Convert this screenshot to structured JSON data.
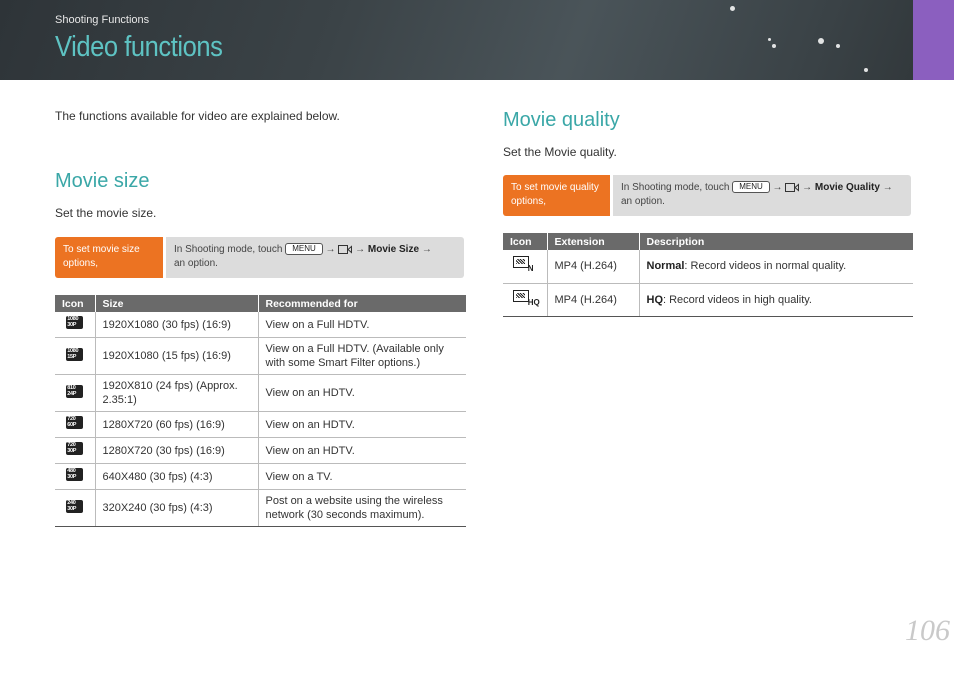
{
  "header": {
    "section": "Shooting Functions",
    "title": "Video functions"
  },
  "intro": "The functions available for video are explained below.",
  "movie_size": {
    "heading": "Movie size",
    "subtitle": "Set the movie size.",
    "howto_label": "To set movie size options,",
    "howto_prefix": "In Shooting mode, touch",
    "menu_key": "MENU",
    "arrow": "→",
    "target": "Movie Size",
    "howto_suffix": "an option.",
    "columns": [
      "Icon",
      "Size",
      "Recommended for"
    ],
    "rows": [
      {
        "icon_top": "1080",
        "icon_bot": "30P",
        "size": "1920X1080 (30 fps) (16:9)",
        "rec": "View on a Full HDTV."
      },
      {
        "icon_top": "1080",
        "icon_bot": "15P",
        "size": "1920X1080 (15 fps) (16:9)",
        "rec": "View on a Full HDTV. (Available only with some Smart Filter options.)"
      },
      {
        "icon_top": "810",
        "icon_bot": "24P",
        "size": "1920X810 (24 fps) (Approx. 2.35:1)",
        "rec": "View on an HDTV."
      },
      {
        "icon_top": "720",
        "icon_bot": "60P",
        "size": "1280X720 (60 fps) (16:9)",
        "rec": "View on an HDTV."
      },
      {
        "icon_top": "720",
        "icon_bot": "30P",
        "size": "1280X720 (30 fps) (16:9)",
        "rec": "View on an HDTV."
      },
      {
        "icon_top": "480",
        "icon_bot": "30P",
        "size": "640X480 (30 fps) (4:3)",
        "rec": "View on a TV."
      },
      {
        "icon_top": "240",
        "icon_bot": "30P",
        "size": "320X240 (30 fps) (4:3)",
        "rec": "Post on a website using the wireless network (30 seconds maximum)."
      }
    ]
  },
  "movie_quality": {
    "heading": "Movie quality",
    "subtitle": "Set the Movie quality.",
    "howto_label": "To set movie quality options,",
    "howto_prefix": "In Shooting mode, touch",
    "menu_key": "MENU",
    "arrow": "→",
    "target": "Movie Quality",
    "howto_suffix": "an option.",
    "columns": [
      "Icon",
      "Extension",
      "Description"
    ],
    "rows": [
      {
        "icon_tag": "N",
        "ext": "MP4 (H.264)",
        "term": "Normal",
        "desc": ": Record videos in normal quality."
      },
      {
        "icon_tag": "HQ",
        "ext": "MP4 (H.264)",
        "term": "HQ",
        "desc": ": Record videos in high quality."
      }
    ]
  },
  "page_number": "106",
  "colors": {
    "accent_teal": "#3aa7a7",
    "orange": "#ec7322",
    "purple_tab": "#8b5fbf",
    "table_header": "#6a6a6a"
  }
}
